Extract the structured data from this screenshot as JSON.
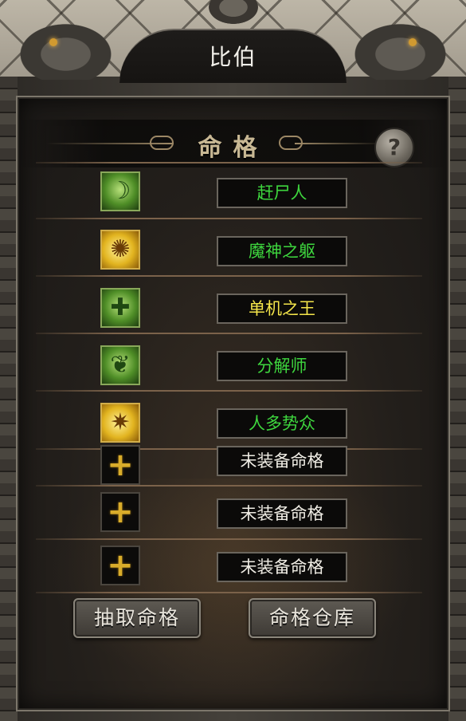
{
  "header": {
    "title": "比伯"
  },
  "section": {
    "title": "命格",
    "help_label": "?"
  },
  "slots": [
    {
      "icon": "ghost-figure-icon",
      "glyph": "☽",
      "icon_tone": "green",
      "name": "赶尸人",
      "name_color": "green"
    },
    {
      "icon": "demon-burst-icon",
      "glyph": "✺",
      "icon_tone": "yellow",
      "name": "魔神之躯",
      "name_color": "green"
    },
    {
      "icon": "cross-shield-icon",
      "glyph": "✚",
      "icon_tone": "green",
      "name": "单机之王",
      "name_color": "yellow"
    },
    {
      "icon": "dissolve-icon",
      "glyph": "❦",
      "icon_tone": "green",
      "name": "分解师",
      "name_color": "green"
    },
    {
      "icon": "crowd-beast-icon",
      "glyph": "✷",
      "icon_tone": "yellow",
      "name": "人多势众",
      "name_color": "green"
    },
    {
      "icon": "empty-slot-plus-icon",
      "glyph": "+",
      "icon_tone": "empty",
      "name": "未装备命格",
      "name_color": "white"
    },
    {
      "icon": "empty-slot-plus-icon",
      "glyph": "+",
      "icon_tone": "empty",
      "name": "未装备命格",
      "name_color": "white"
    },
    {
      "icon": "empty-slot-plus-icon",
      "glyph": "+",
      "icon_tone": "empty",
      "name": "未装备命格",
      "name_color": "white"
    }
  ],
  "buttons": {
    "draw": "抽取命格",
    "storage": "命格仓库"
  },
  "colors": {
    "green_text": "#3ed63e",
    "yellow_text": "#f4e54a",
    "white_text": "#efece4",
    "gold_plus": "#d9ac2a"
  }
}
